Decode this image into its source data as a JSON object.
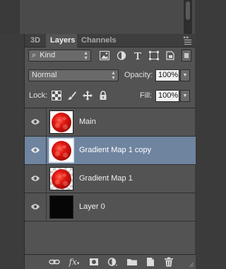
{
  "panel": {
    "tabs": [
      {
        "label": "3D",
        "active": false
      },
      {
        "label": "Layers",
        "active": true
      },
      {
        "label": "Channels",
        "active": false
      }
    ]
  },
  "filter": {
    "kind_label": "Kind",
    "icons": [
      "image-filter-icon",
      "adjustment-filter-icon",
      "type-filter-icon",
      "shape-filter-icon",
      "smart-object-filter-icon"
    ]
  },
  "blend": {
    "mode": "Normal",
    "opacity_label": "Opacity:",
    "opacity_value": "100%"
  },
  "lock": {
    "label": "Lock:",
    "fill_label": "Fill:",
    "fill_value": "100%"
  },
  "layers": [
    {
      "name": "Main",
      "visible": true,
      "selected": false,
      "thumb": "red-ball-on-white"
    },
    {
      "name": "Gradient Map 1 copy",
      "visible": true,
      "selected": true,
      "thumb": "red-ball-on-white"
    },
    {
      "name": "Gradient Map 1",
      "visible": true,
      "selected": false,
      "thumb": "red-ball-on-transparent"
    },
    {
      "name": "Layer 0",
      "visible": true,
      "selected": false,
      "thumb": "black-fill"
    }
  ],
  "colors": {
    "panel_bg": "#535353",
    "selected_row": "#6f849f",
    "tab_bar": "#3e3e3e"
  }
}
